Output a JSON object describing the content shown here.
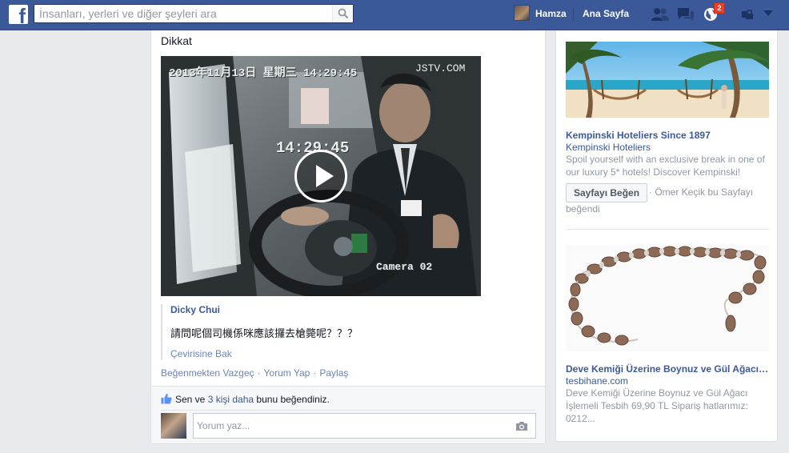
{
  "topbar": {
    "search_placeholder": "İnsanları, yerleri ve diğer şeyleri ara",
    "user_name": "Hamza",
    "home_label": "Ana Sayfa",
    "notification_count": "2",
    "icons": [
      "facebook-logo",
      "search-icon",
      "friend-requests-icon",
      "messages-icon",
      "notifications-globe-icon",
      "privacy-lock-icon",
      "settings-arrow-icon"
    ]
  },
  "post": {
    "text": "Dikkat",
    "video": {
      "overlay_datetime": "2013年11月13日 星期三 14:29:45",
      "overlay_source": "JSTV.COM",
      "overlay_clock": "14:29:45",
      "overlay_camera": "Camera 02"
    },
    "shared": {
      "author": "Dicky Chui",
      "text": "請問呢個司機係咪應該攞去槍斃呢？？？",
      "translate_label": "Çevirisine Bak"
    },
    "actions": {
      "unlike": "Beğenmekten Vazgeç",
      "comment": "Yorum Yap",
      "share": "Paylaş"
    },
    "likes": {
      "prefix": "Sen ve",
      "link": "3 kişi daha",
      "suffix": "bunu beğendiniz."
    },
    "comment_placeholder": "Yorum yaz..."
  },
  "ads": [
    {
      "title": "Kempinski Hoteliers Since 1897",
      "subtitle": "Kempinski Hoteliers",
      "description": "Spoil yourself with an exclusive break in one of our luxury 5* hotels! Discover Kempinski!",
      "button_label": "Sayfayı Beğen",
      "social": "· Ömer Keçik bu Sayfayı beğendi"
    },
    {
      "title": "Deve Kemiği Üzerine Boynuz ve Gül Ağacı İ...",
      "subtitle": "tesbihane.com",
      "description": "Deve Kemiği Üzerine Boynuz ve Gül Ağacı İşlemeli Tesbih 69,90 TL Sipariş hatlarımız: 0212..."
    }
  ],
  "colors": {
    "brand_blue": "#3b5998",
    "page_bg": "#e9eaed",
    "link_blue": "#3b5998",
    "badge_red": "#f03d25"
  }
}
